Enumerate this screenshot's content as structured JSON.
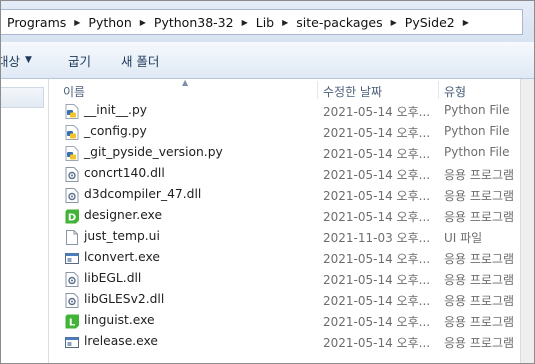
{
  "breadcrumb": [
    "Programs",
    "Python",
    "Python38-32",
    "Lib",
    "site-packages",
    "PySide2"
  ],
  "toolbar": {
    "organize_label": "대상",
    "share_label": "굽기",
    "new_folder_label": "새 폴더"
  },
  "columns": {
    "name": "이름",
    "date": "수정한 날짜",
    "type": "유형"
  },
  "files": [
    {
      "icon": "python-file-icon",
      "name": "__init__.py",
      "date": "2021-05-14 오후...",
      "type": "Python File"
    },
    {
      "icon": "python-file-icon",
      "name": "_config.py",
      "date": "2021-05-14 오후...",
      "type": "Python File"
    },
    {
      "icon": "python-file-icon",
      "name": "_git_pyside_version.py",
      "date": "2021-05-14 오후...",
      "type": "Python File"
    },
    {
      "icon": "dll-file-icon",
      "name": "concrt140.dll",
      "date": "2021-05-14 오후...",
      "type": "응용 프로그램"
    },
    {
      "icon": "dll-file-icon",
      "name": "d3dcompiler_47.dll",
      "date": "2021-05-14 오후...",
      "type": "응용 프로그램"
    },
    {
      "icon": "designer-app-icon",
      "name": "designer.exe",
      "date": "2021-05-14 오후...",
      "type": "응용 프로그램"
    },
    {
      "icon": "blank-file-icon",
      "name": "just_temp.ui",
      "date": "2021-11-03 오후...",
      "type": "UI 파일"
    },
    {
      "icon": "exe-window-icon",
      "name": "lconvert.exe",
      "date": "2021-05-14 오후...",
      "type": "응용 프로그램"
    },
    {
      "icon": "dll-file-icon",
      "name": "libEGL.dll",
      "date": "2021-05-14 오후...",
      "type": "응용 프로그램"
    },
    {
      "icon": "dll-file-icon",
      "name": "libGLESv2.dll",
      "date": "2021-05-14 오후...",
      "type": "응용 프로그램"
    },
    {
      "icon": "linguist-app-icon",
      "name": "linguist.exe",
      "date": "2021-05-14 오후...",
      "type": "응용 프로그램"
    },
    {
      "icon": "exe-window-icon",
      "name": "lrelease.exe",
      "date": "2021-05-14 오후...",
      "type": "응용 프로그램"
    }
  ],
  "icon_colors": {
    "designer": "#41b336",
    "linguist": "#41b336",
    "python_blue": "#3a70b0",
    "python_yellow": "#f2c528"
  }
}
